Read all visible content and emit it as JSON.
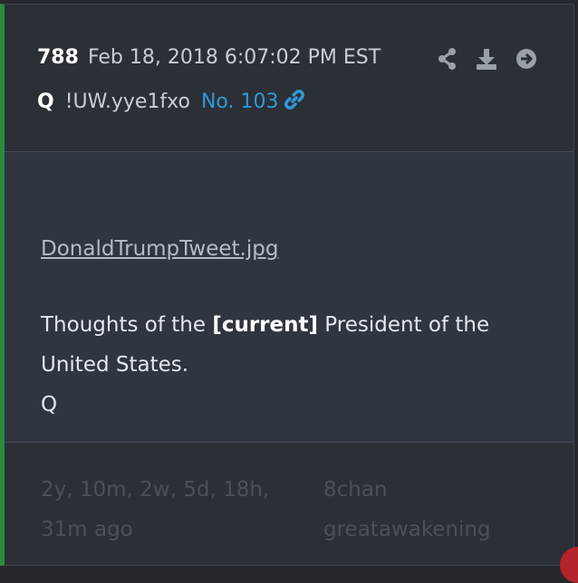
{
  "post": {
    "number": "788",
    "datetime": "Feb 18, 2018 6:07:02 PM EST",
    "author": "Q",
    "tripcode": "!UW.yye1fxo",
    "post_id": "No. 103",
    "attachment": "DonaldTrumpTweet.jpg",
    "text_before": "Thoughts of the ",
    "text_bold": "[current]",
    "text_after": " President of the United States.",
    "signature": "Q"
  },
  "footer": {
    "ago": "2y, 10m, 2w, 5d, 18h, 31m ago",
    "source": "8chan greatawakening"
  },
  "icons": [
    "share-icon",
    "download-icon",
    "arrow-right-circle-icon",
    "link-icon"
  ],
  "colors": {
    "accent_border": "#2c8a3d",
    "link": "#2e9ad6",
    "background": "#2b2f36"
  }
}
